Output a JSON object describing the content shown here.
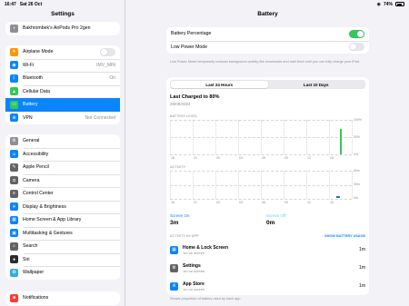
{
  "status_bar": {
    "time": "16:47",
    "date": "Sat 26 Oct",
    "battery": "74%"
  },
  "sidebar": {
    "title": "Settings",
    "device": "Bakhrombek's AirPods Pro 2gen",
    "group1": [
      {
        "label": "Airplane Mode",
        "icon": "airplane-icon",
        "color": "#ff9500",
        "glyph": "✈"
      },
      {
        "label": "Wi-Fi",
        "value": "IMV_MIN",
        "icon": "wifi-icon",
        "color": "#0a84ff",
        "glyph": "◉"
      },
      {
        "label": "Bluetooth",
        "value": "On",
        "icon": "bluetooth-icon",
        "color": "#0a84ff",
        "glyph": "ᛒ"
      },
      {
        "label": "Cellular Data",
        "icon": "cellular-icon",
        "color": "#34c759",
        "glyph": "▲"
      },
      {
        "label": "Battery",
        "icon": "battery-icon",
        "color": "#34c759",
        "glyph": "▭"
      },
      {
        "label": "VPN",
        "value": "Not Connected",
        "icon": "vpn-icon",
        "color": "#0a84ff",
        "glyph": "⊕"
      }
    ],
    "group2": [
      {
        "label": "General",
        "icon": "gear-icon",
        "color": "#8e8e93",
        "glyph": "⚙"
      },
      {
        "label": "Accessibility",
        "icon": "accessibility-icon",
        "color": "#0a84ff",
        "glyph": "☺"
      },
      {
        "label": "Apple Pencil",
        "icon": "pencil-icon",
        "color": "#636366",
        "glyph": "✎"
      },
      {
        "label": "Camera",
        "icon": "camera-icon",
        "color": "#636366",
        "glyph": "◘"
      },
      {
        "label": "Control Center",
        "icon": "control-center-icon",
        "color": "#636366",
        "glyph": "≡"
      },
      {
        "label": "Display & Brightness",
        "icon": "brightness-icon",
        "color": "#0a84ff",
        "glyph": "☀"
      },
      {
        "label": "Home Screen & App Library",
        "icon": "home-screen-icon",
        "color": "#0a84ff",
        "glyph": "▦"
      },
      {
        "label": "Multitasking & Gestures",
        "icon": "multitasking-icon",
        "color": "#0a84ff",
        "glyph": "▣"
      },
      {
        "label": "Search",
        "icon": "search-icon",
        "color": "#636366",
        "glyph": "⌕"
      },
      {
        "label": "Siri",
        "icon": "siri-icon",
        "color": "#2c2c2e",
        "glyph": "●"
      },
      {
        "label": "Wallpaper",
        "icon": "wallpaper-icon",
        "color": "#32ade6",
        "glyph": "✿"
      }
    ],
    "group3": [
      {
        "label": "Notifications",
        "icon": "notifications-icon",
        "color": "#ff3b30",
        "glyph": "■"
      }
    ]
  },
  "main": {
    "title": "Battery",
    "battery_percentage": "Battery Percentage",
    "low_power_mode": "Low Power Mode",
    "footnote": "Low Power Mode temporarily reduces background activity like downloads and mail fetch until you can fully charge your iPad.",
    "tabs": [
      "Last 24 Hours",
      "Last 10 Days"
    ],
    "last_charged": "Last Charged to 80%",
    "charged_date": "29/09/2024",
    "battery_level_label": "BATTERY LEVEL",
    "activity_label": "ACTIVITY",
    "level_ticks": [
      "100%",
      "50%",
      "0%"
    ],
    "activity_ticks": [
      "60m",
      "30m",
      "0m"
    ],
    "x_ticks": [
      "18",
      "21",
      "00",
      "03",
      "06",
      "09",
      "12",
      "15"
    ],
    "screen_on_label": "Screen On",
    "screen_on_value": "3m",
    "screen_off_label": "Screen Off",
    "screen_off_value": "0m",
    "activity_by_app": "ACTIVITY BY APP",
    "show_usage": "SHOW BATTERY USAGE",
    "apps": [
      {
        "name": "Home & Lock Screen",
        "sub": "1m on screen",
        "time": "1m",
        "icon": "home-lock-icon",
        "color": "#0a84ff",
        "glyph": "▦"
      },
      {
        "name": "Settings",
        "sub": "1m on screen",
        "time": "1m",
        "icon": "settings-app-icon",
        "color": "#636366",
        "glyph": "⚙"
      },
      {
        "name": "App Store",
        "sub": "1m on screen",
        "time": "1m",
        "icon": "app-store-icon",
        "color": "#0a84ff",
        "glyph": "A"
      }
    ],
    "bottom_note": "Shows proportion of battery used by each app"
  }
}
